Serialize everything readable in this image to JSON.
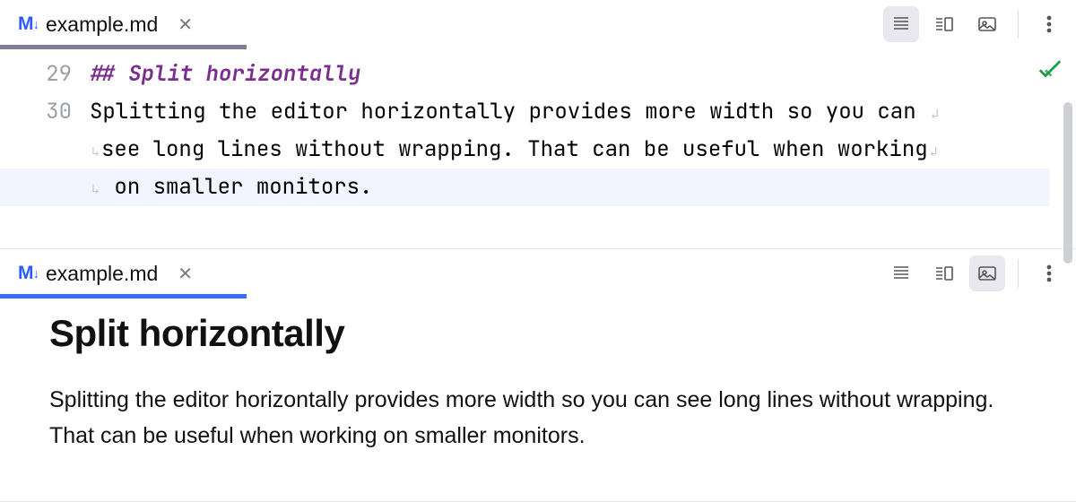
{
  "file": {
    "name": "example.md",
    "icon_text": "M",
    "icon_arrow": "↓"
  },
  "toolbar": {
    "buttons": [
      "source-view",
      "split-view",
      "preview-view"
    ],
    "more": "⋮"
  },
  "source_pane": {
    "active_view": "source-view",
    "line_start": 29,
    "lines": [
      {
        "n": 29,
        "raw": "## Split horizontally",
        "kind": "heading"
      },
      {
        "n": 30,
        "raw": "Splitting the editor horizontally provides more width so you can ",
        "wrap_after": true
      },
      {
        "n": "",
        "raw": "see long lines without wrapping. That can be useful when working",
        "wrap_before": true,
        "wrap_after": true
      },
      {
        "n": "",
        "raw": " on smaller monitors.",
        "wrap_before": true,
        "highlight": true
      }
    ],
    "status_ok": true
  },
  "preview_pane": {
    "active_view": "preview-view",
    "heading": "Split horizontally",
    "paragraph": "Splitting the editor horizontally provides more width so you can see long lines without wrapping. That can be useful when working on smaller monitors."
  }
}
